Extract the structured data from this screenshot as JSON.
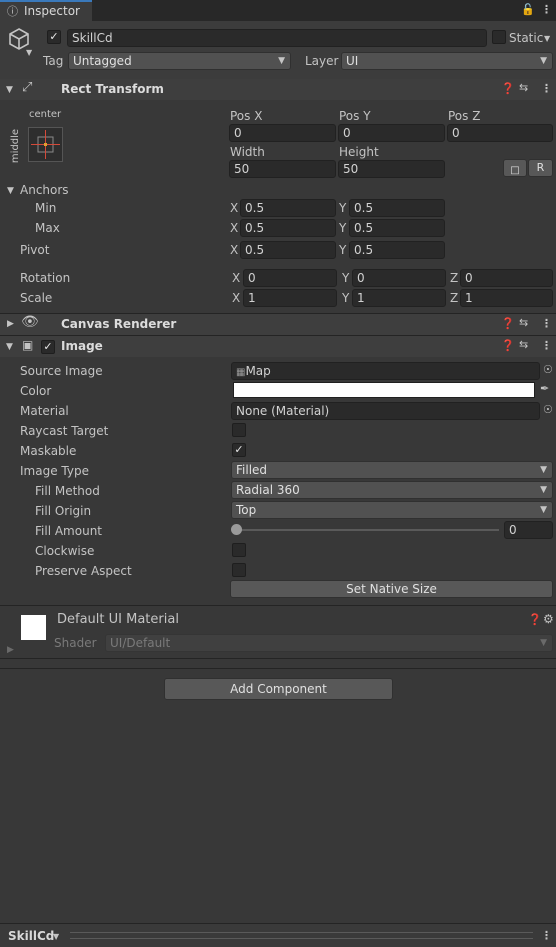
{
  "tab": {
    "title": "Inspector"
  },
  "object": {
    "name": "SkillCd",
    "static_label": "Static",
    "tag_label": "Tag",
    "tag_value": "Untagged",
    "layer_label": "Layer",
    "layer_value": "UI"
  },
  "rect_transform": {
    "title": "Rect Transform",
    "anchor_preset_top": "center",
    "anchor_preset_side": "middle",
    "labels": {
      "pos_x": "Pos X",
      "pos_y": "Pos Y",
      "pos_z": "Pos Z",
      "width": "Width",
      "height": "Height"
    },
    "values": {
      "pos_x": "0",
      "pos_y": "0",
      "pos_z": "0",
      "width": "50",
      "height": "50"
    },
    "raw_edit_label": "R",
    "anchors_label": "Anchors",
    "min_label": "Min",
    "min_x": "0.5",
    "min_y": "0.5",
    "max_label": "Max",
    "max_x": "0.5",
    "max_y": "0.5",
    "pivot_label": "Pivot",
    "pivot_x": "0.5",
    "pivot_y": "0.5",
    "rotation_label": "Rotation",
    "rotation": {
      "x": "0",
      "y": "0",
      "z": "0"
    },
    "scale_label": "Scale",
    "scale": {
      "x": "1",
      "y": "1",
      "z": "1"
    },
    "axis": {
      "x": "X",
      "y": "Y",
      "z": "Z"
    }
  },
  "canvas_renderer": {
    "title": "Canvas Renderer"
  },
  "image": {
    "title": "Image",
    "rows": {
      "source_image": {
        "label": "Source Image",
        "value": "Map"
      },
      "color": {
        "label": "Color"
      },
      "material": {
        "label": "Material",
        "value": "None (Material)"
      },
      "raycast_target": {
        "label": "Raycast Target"
      },
      "maskable": {
        "label": "Maskable"
      },
      "image_type": {
        "label": "Image Type",
        "value": "Filled"
      },
      "fill_method": {
        "label": "Fill Method",
        "value": "Radial 360"
      },
      "fill_origin": {
        "label": "Fill Origin",
        "value": "Top"
      },
      "fill_amount": {
        "label": "Fill Amount",
        "value": "0"
      },
      "clockwise": {
        "label": "Clockwise"
      },
      "preserve_aspect": {
        "label": "Preserve Aspect"
      }
    },
    "states": {
      "raycast_target": false,
      "maskable": true,
      "clockwise": false,
      "preserve_aspect": false
    },
    "fill_amount_level": 0,
    "set_native_size": "Set Native Size"
  },
  "material_preview": {
    "title": "Default UI Material",
    "shader_label": "Shader",
    "shader_value": "UI/Default"
  },
  "add_component": "Add Component",
  "footer": {
    "selection": "SkillCd"
  },
  "colors": {
    "panel": "#383838",
    "header": "#3e3e3e",
    "field": "#2a2a2a",
    "accent_red": "#d44a3a"
  }
}
